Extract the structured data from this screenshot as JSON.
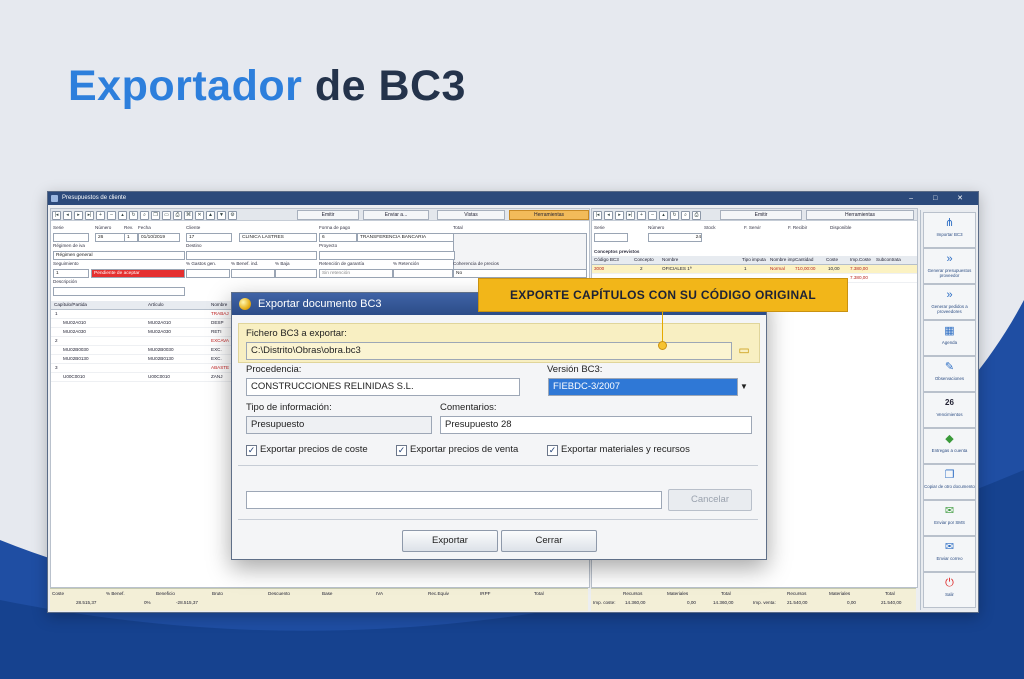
{
  "headline": {
    "accent": "Exportador",
    "rest": " de BC3"
  },
  "callout": {
    "text": "EXPORTE CAPÍTULOS CON SU CÓDIGO ORIGINAL"
  },
  "app": {
    "title": "Presupuestos de cliente",
    "window_controls": "– □ ✕",
    "left_toolbar": {
      "emitir": "Emitir",
      "enviar": "Enviar a...",
      "vistas": "Vistas",
      "herramientas": "Herramientas"
    },
    "right_toolbar": {
      "emitir": "Emitir",
      "herramientas": "Herramientas"
    },
    "header_fields": {
      "serie_label": "Serie",
      "numero_label": "Número",
      "rev_label": "Rev.",
      "fecha_label": "Fecha",
      "cliente_label": "Cliente",
      "forma_pago_label": "Forma de pago",
      "total_label": "Total",
      "numero": "26",
      "rev": "1",
      "fecha": "01/10/2019",
      "cliente_num": "17",
      "cliente_nombre": "CLINICA LASTRES",
      "forma_pago_num": "6",
      "forma_pago_nombre": "TRANSFERENCIA BANCARIA",
      "regimen_iva_label": "Régimen de iva",
      "regimen_iva": "Régimen general",
      "destino_label": "Destino",
      "proyecto_label": "Proyecto",
      "seguimiento_label": "Seguimiento",
      "seguimiento_num": "1",
      "seguimiento_estado": "Pendiente de aceptar",
      "gastos_gen_label": "% Gastos gen.",
      "benef_ind_label": "% Benef. ind.",
      "baja_label": "% Baja",
      "retencion_garantia_label": "Retención de garantía",
      "retencion_garantia": "Sin retención",
      "pct_retencion_label": "% Retención",
      "coherencia_label": "Coherencia de precios",
      "coherencia": "No",
      "descripcion_label": "Descripción"
    },
    "left_grid": {
      "headers": [
        "Capítulo/Partida",
        "Artículo",
        "Nombre"
      ],
      "rows": [
        {
          "code": "1",
          "articulo": "",
          "nombre": "TRABAJ",
          "kind": "chapter"
        },
        {
          "code": "MU02A010",
          "articulo": "MU02A010",
          "nombre": "DESP",
          "kind": "item"
        },
        {
          "code": "MU02A030",
          "articulo": "MU02A030",
          "nombre": "RETI",
          "kind": "item"
        },
        {
          "code": "2",
          "articulo": "",
          "nombre": "EXCAVA",
          "kind": "chapter"
        },
        {
          "code": "MU02B0030",
          "articulo": "MU02B0030",
          "nombre": "EXC.",
          "kind": "item"
        },
        {
          "code": "MU02B0130",
          "articulo": "MU02B0130",
          "nombre": "EXC.",
          "kind": "item"
        },
        {
          "code": "3",
          "articulo": "",
          "nombre": "ABASTE",
          "kind": "chapter"
        },
        {
          "code": "U00C0010",
          "articulo": "U00C0010",
          "nombre": "ZANJ",
          "kind": "item"
        }
      ]
    },
    "right_header": {
      "serie_label": "Serie",
      "numero_label": "Número",
      "stock_label": "Stock",
      "f_servir_label": "F. Servir",
      "f_recibir_label": "F. Recibir",
      "disponible_label": "Disponible",
      "numero": "24"
    },
    "right_grid": {
      "title": "Conceptos previstos",
      "headers": [
        "Código BC3",
        "Concepto",
        "Nombre",
        "Tipo imputa",
        "Nombre imp",
        "Cantidad",
        "Coste",
        "Imp.Coste",
        "Subcontrata"
      ],
      "rows": [
        {
          "codigo": "3000",
          "concepto": "2",
          "nombre": "OFICIALES 1ª",
          "tipo": "1",
          "nombre_imp": "Normal",
          "cantidad": "710,00:00",
          "coste": "10,00",
          "imp_coste": "7.380,00"
        },
        {
          "codigo": "",
          "concepto": "",
          "nombre": "",
          "tipo": "",
          "nombre_imp": "",
          "cantidad": "",
          "coste": "",
          "imp_coste": "7.380,00"
        }
      ]
    },
    "left_footer": {
      "labels": [
        "Coste",
        "% Benef.",
        "Beneficio",
        "Bruto",
        "Descuento",
        "Base",
        "IVA",
        "Rec.Equiv",
        "IRPF",
        "Total"
      ],
      "coste": "28.515,37",
      "benef_pct": "0%",
      "beneficio": "-28.515,37"
    },
    "right_footer": {
      "recursos_label": "Recursos",
      "materiales_label": "Materiales",
      "total_label": "Total",
      "imp_coste_label": "Imp. coste:",
      "imp_venta_label": "Imp. venta:",
      "coste_recursos": "14.360,00",
      "coste_materiales": "0,00",
      "coste_total": "14.360,00",
      "venta_recursos": "21.540,00",
      "venta_materiales": "0,00",
      "venta_total": "21.540,00"
    },
    "sidebar": [
      {
        "label": "Importar BC3",
        "icon": "network-icon",
        "glyph": "⋔"
      },
      {
        "label": "Generar presupuestos proveedor",
        "icon": "arrows-icon",
        "glyph": "»"
      },
      {
        "label": "Generar pedidos a proveedores",
        "icon": "arrows-icon",
        "glyph": "»"
      },
      {
        "label": "Agenda",
        "icon": "calendar-grid-icon",
        "glyph": "▦"
      },
      {
        "label": "Observaciones",
        "icon": "notes-icon",
        "glyph": "✎"
      },
      {
        "label": "Vencimientos",
        "icon": "calendar-icon",
        "glyph": "26"
      },
      {
        "label": "Entregas a cuenta",
        "icon": "money-icon",
        "glyph": "◆"
      },
      {
        "label": "Copiar de otro documento",
        "icon": "copy-icon",
        "glyph": "❐"
      },
      {
        "label": "Enviar por SMS",
        "icon": "sms-icon",
        "glyph": "✉"
      },
      {
        "label": "Enviar correo",
        "icon": "mail-icon",
        "glyph": "✉"
      },
      {
        "label": "Salir",
        "icon": "power-icon",
        "glyph": "⏻"
      }
    ]
  },
  "dialog": {
    "title": "Exportar documento BC3",
    "fichero_label": "Fichero BC3 a exportar:",
    "fichero_value": "C:\\Distrito\\Obras\\obra.bc3",
    "procedencia_label": "Procedencia:",
    "procedencia_value": "CONSTRUCCIONES RELINIDAS S.L.",
    "version_label": "Versión BC3:",
    "version_value": "FIEBDC-3/2007",
    "tipo_label": "Tipo de información:",
    "tipo_value": "Presupuesto",
    "comentarios_label": "Comentarios:",
    "comentarios_value": "Presupuesto 28",
    "chk_coste": "Exportar precios de coste",
    "chk_venta": "Exportar precios de venta",
    "chk_materiales": "Exportar materiales y recursos",
    "cancelar_progress": "Cancelar",
    "exportar": "Exportar",
    "cerrar": "Cerrar"
  },
  "colors": {
    "accent": "#2d7fdc",
    "dark_text": "#24334b",
    "callout": "#f2b619",
    "wave": "#1f4ea3",
    "selected": "#2f78d6"
  }
}
